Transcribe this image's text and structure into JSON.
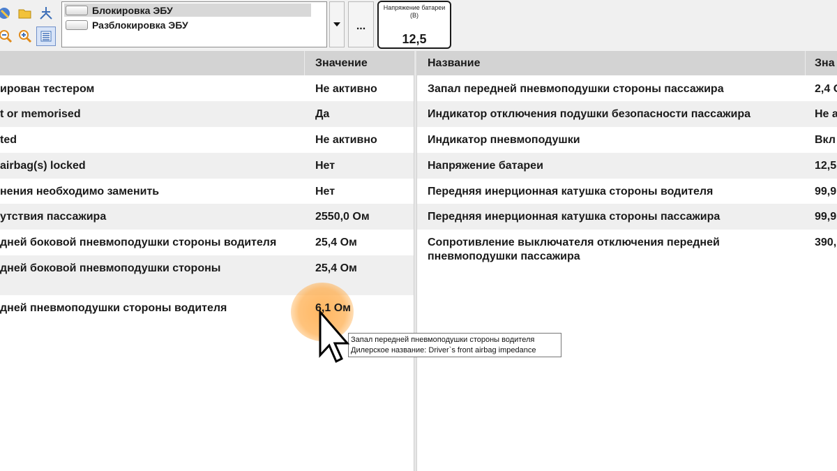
{
  "toolbar": {
    "tools": [
      {
        "name": "diagnostic-icon"
      },
      {
        "name": "open-folder-icon"
      },
      {
        "name": "network-icon"
      },
      {
        "name": "zoom-out-icon"
      },
      {
        "name": "zoom-in-icon"
      },
      {
        "name": "list-view-icon",
        "active": true
      }
    ],
    "commands": [
      "Блокировка ЭБУ",
      "Разблокировка ЭБУ"
    ],
    "selected_command": 0,
    "more_label": "...",
    "battery": {
      "label": "Напряжение батареи (В)",
      "value": "12,5"
    }
  },
  "left_table": {
    "headers": [
      "",
      "Значение"
    ],
    "rows": [
      {
        "name": "ирован тестером",
        "value": "Не активно"
      },
      {
        "name": "t or memorised",
        "value": "Да"
      },
      {
        "name": "ted",
        "value": "Не активно"
      },
      {
        "name": "airbag(s) locked",
        "value": "Нет"
      },
      {
        "name": "нения необходимо заменить",
        "value": "Нет"
      },
      {
        "name": "утствия пассажира",
        "value": "2550,0 Ом"
      },
      {
        "name": "дней боковой пневмоподушки стороны водителя",
        "value": "25,4 Ом"
      },
      {
        "name": "дней боковой пневмоподушки стороны",
        "value": "25,4 Ом"
      },
      {
        "name": "дней пневмоподушки стороны водителя",
        "value": "6,1 Ом"
      }
    ]
  },
  "right_table": {
    "headers": [
      "Название",
      "Зна"
    ],
    "rows": [
      {
        "name": "Запал передней пневмоподушки стороны пассажира",
        "value": "2,4 О"
      },
      {
        "name": "Индикатор отключения подушки безопасности пассажира",
        "value": "Не а"
      },
      {
        "name": "Индикатор пневмоподушки",
        "value": "Вкл"
      },
      {
        "name": "Напряжение батареи",
        "value": "12,5"
      },
      {
        "name": "Передняя инерционная катушка стороны водителя",
        "value": "99,9"
      },
      {
        "name": "Передняя инерционная катушка стороны пассажира",
        "value": "99,9"
      },
      {
        "name": "Сопротивление выключателя отключения передней пневмоподушки пассажира",
        "value": "390,"
      }
    ]
  },
  "tooltip": {
    "line1": "Запал передней пневмоподушки стороны водителя",
    "line2": "Дилерское название: Driver`s front airbag impedance"
  },
  "colors": {
    "header_bg": "#d3d3d3",
    "row_alt": "#efefef",
    "highlight": "#ffaa46",
    "active_tool": "#6f8fc8"
  }
}
